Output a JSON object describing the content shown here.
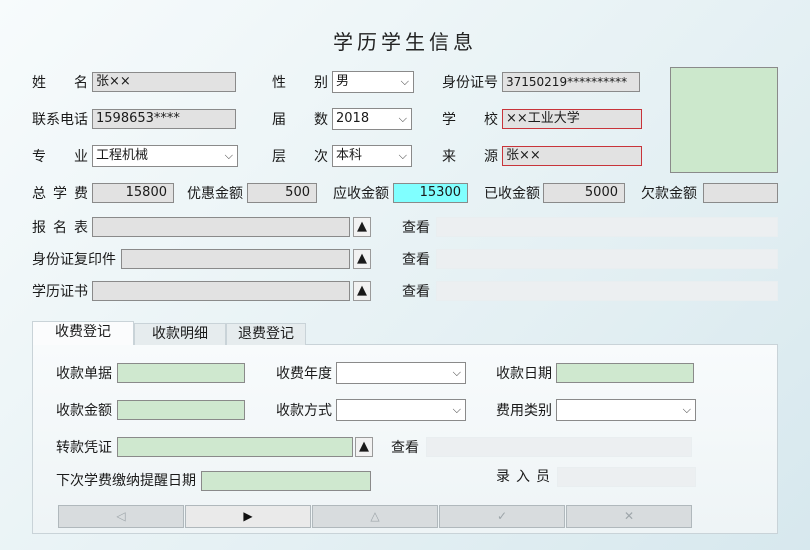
{
  "title": "学历学生信息",
  "row1": {
    "name_label": "姓名",
    "name_value": "张××",
    "gender_label": "性别",
    "gender_value": "男",
    "id_label": "身份证号",
    "id_value": "37150219**********"
  },
  "row2": {
    "phone_label": "联系电话",
    "phone_value": "1598653****",
    "session_label": "届数",
    "session_value": "2018",
    "school_label": "学校",
    "school_value": "××工业大学"
  },
  "row3": {
    "major_label": "专业",
    "major_value": "工程机械",
    "level_label": "层次",
    "level_value": "本科",
    "source_label": "来源",
    "source_value": "张××"
  },
  "fees": {
    "total_label": "总学费",
    "total_value": "15800",
    "discount_label": "优惠金额",
    "discount_value": "500",
    "due_label": "应收金额",
    "due_value": "15300",
    "received_label": "已收金额",
    "received_value": "5000",
    "owed_label": "欠款金额",
    "owed_value": ""
  },
  "attachments": [
    {
      "label": "报名表",
      "view": "查看"
    },
    {
      "label": "身份证复印件",
      "view": "查看"
    },
    {
      "label": "学历证书",
      "view": "查看"
    }
  ],
  "upload_glyph": "▲",
  "tabs": [
    "收费登记",
    "收款明细",
    "退费登记"
  ],
  "payment": {
    "receipt_label": "收款单据",
    "receipt_value": "",
    "year_label": "收费年度",
    "year_value": "",
    "date_label": "收款日期",
    "date_value": "",
    "amount_label": "收款金额",
    "amount_value": "",
    "method_label": "收款方式",
    "method_value": "",
    "category_label": "费用类别",
    "category_value": "",
    "voucher_label": "转款凭证",
    "voucher_value": "",
    "voucher_view": "查看",
    "reminder_label": "下次学费缴纳提醒日期",
    "reminder_value": "",
    "operator_label": "录入员",
    "operator_value": ""
  },
  "nav": [
    "◁",
    "▶",
    "△",
    "✓",
    "✕"
  ],
  "colors": {
    "required_border": "#c8343a",
    "highlight": "#80ffff",
    "editable": "#cfe8cf"
  }
}
